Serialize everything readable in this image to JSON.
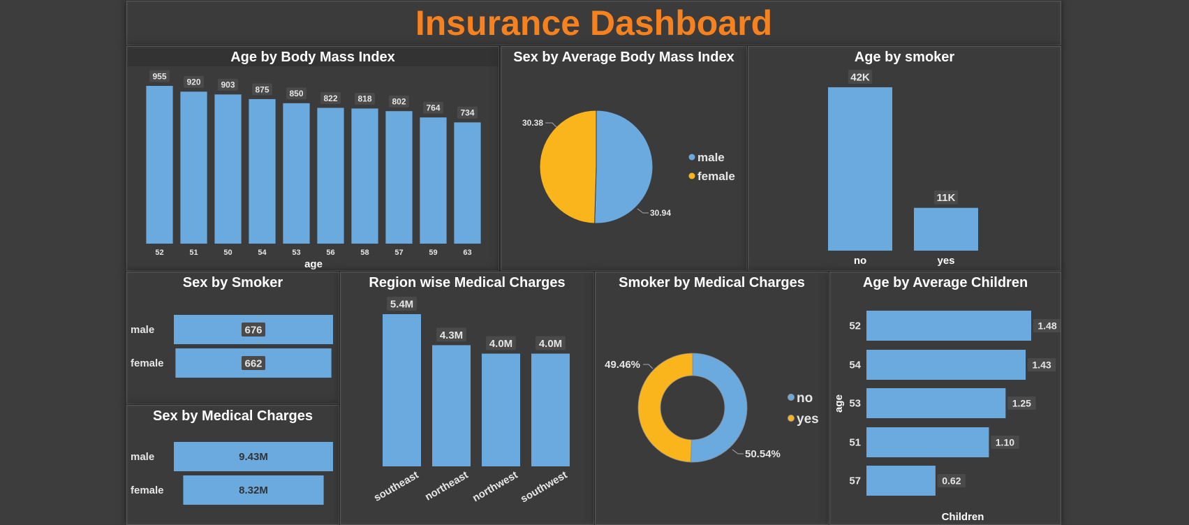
{
  "dashboard": {
    "title": "Insurance Dashboard"
  },
  "colors": {
    "bar": "#6aaadf",
    "male": "#6aaadf",
    "female": "#fbb51c",
    "title": "#f5821f",
    "background": "#3d3d3d"
  },
  "age_bmi": {
    "title": "Age by Body Mass Index",
    "xlabel": "age",
    "chart_data": {
      "type": "bar",
      "categories": [
        "52",
        "51",
        "50",
        "54",
        "53",
        "56",
        "58",
        "57",
        "59",
        "63"
      ],
      "values": [
        955,
        920,
        903,
        875,
        850,
        822,
        818,
        802,
        764,
        734
      ],
      "xlabel": "age",
      "ylim": [
        0,
        1000
      ]
    }
  },
  "sex_bmi": {
    "title": "Sex by Average Body Mass Index",
    "chart_data": {
      "type": "pie",
      "categories": [
        "male",
        "female"
      ],
      "values": [
        30.94,
        30.38
      ],
      "labels": [
        "30.94",
        "30.38"
      ],
      "legend": "right"
    }
  },
  "age_smoker": {
    "title": "Age by smoker",
    "chart_data": {
      "type": "bar",
      "categories": [
        "no",
        "yes"
      ],
      "values": [
        42000,
        11000
      ],
      "labels": [
        "42K",
        "11K"
      ],
      "ylim": [
        0,
        42000
      ]
    }
  },
  "sex_smoker": {
    "title": "Sex by Smoker",
    "chart_data": {
      "type": "bar",
      "orientation": "horizontal",
      "categories": [
        "male",
        "female"
      ],
      "values": [
        676,
        662
      ],
      "labels": [
        "676",
        "662"
      ]
    }
  },
  "sex_charges": {
    "title": "Sex by Medical Charges",
    "chart_data": {
      "type": "bar",
      "orientation": "horizontal",
      "categories": [
        "male",
        "female"
      ],
      "values": [
        9.43,
        8.32
      ],
      "labels": [
        "9.43M",
        "8.32M"
      ]
    }
  },
  "region_charges": {
    "title": "Region wise Medical Charges",
    "chart_data": {
      "type": "bar",
      "categories": [
        "southeast",
        "northeast",
        "northwest",
        "southwest"
      ],
      "values": [
        5.4,
        4.3,
        4.0,
        4.0
      ],
      "labels": [
        "5.4M",
        "4.3M",
        "4.0M",
        "4.0M"
      ],
      "ylim": [
        0,
        5.4
      ]
    }
  },
  "smoker_charges": {
    "title": "Smoker by Medical Charges",
    "chart_data": {
      "type": "pie",
      "donut": true,
      "categories": [
        "no",
        "yes"
      ],
      "values": [
        50.54,
        49.46
      ],
      "labels": [
        "50.54%",
        "49.46%"
      ],
      "legend": "right"
    }
  },
  "age_children": {
    "title": "Age by Average Children",
    "ylabel": "age",
    "xlabel": "Children",
    "chart_data": {
      "type": "bar",
      "orientation": "horizontal",
      "categories": [
        "52",
        "54",
        "53",
        "51",
        "57"
      ],
      "values": [
        1.48,
        1.43,
        1.25,
        1.1,
        0.62
      ],
      "labels": [
        "1.48",
        "1.43",
        "1.25",
        "1.10",
        "0.62"
      ],
      "ylabel": "age",
      "xlabel": "Children"
    }
  }
}
